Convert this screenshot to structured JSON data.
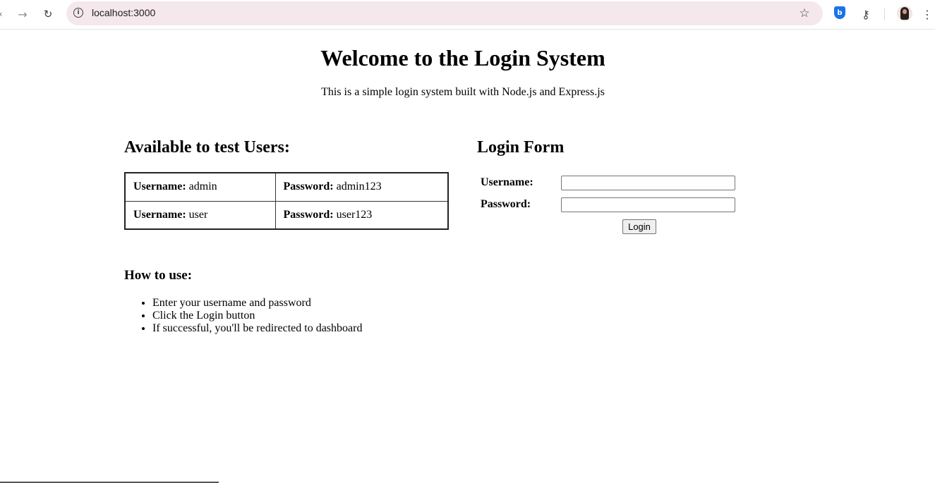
{
  "browser": {
    "url": "localhost:3000"
  },
  "page": {
    "title": "Welcome to the Login System",
    "subtitle": "This is a simple login system built with Node.js and Express.js"
  },
  "test_users": {
    "heading": "Available to test Users:",
    "username_label": "Username:",
    "password_label": "Password:",
    "rows": [
      {
        "username": "admin",
        "password": "admin123"
      },
      {
        "username": "user",
        "password": "user123"
      }
    ]
  },
  "login_form": {
    "heading": "Login Form",
    "username_label": "Username:",
    "password_label": "Password:",
    "username_value": "",
    "password_value": "",
    "submit_label": "Login"
  },
  "how_to_use": {
    "heading": "How to use:",
    "steps": [
      "Enter your username and password",
      "Click the Login button",
      "If successful, you'll be redirected to dashboard"
    ]
  }
}
